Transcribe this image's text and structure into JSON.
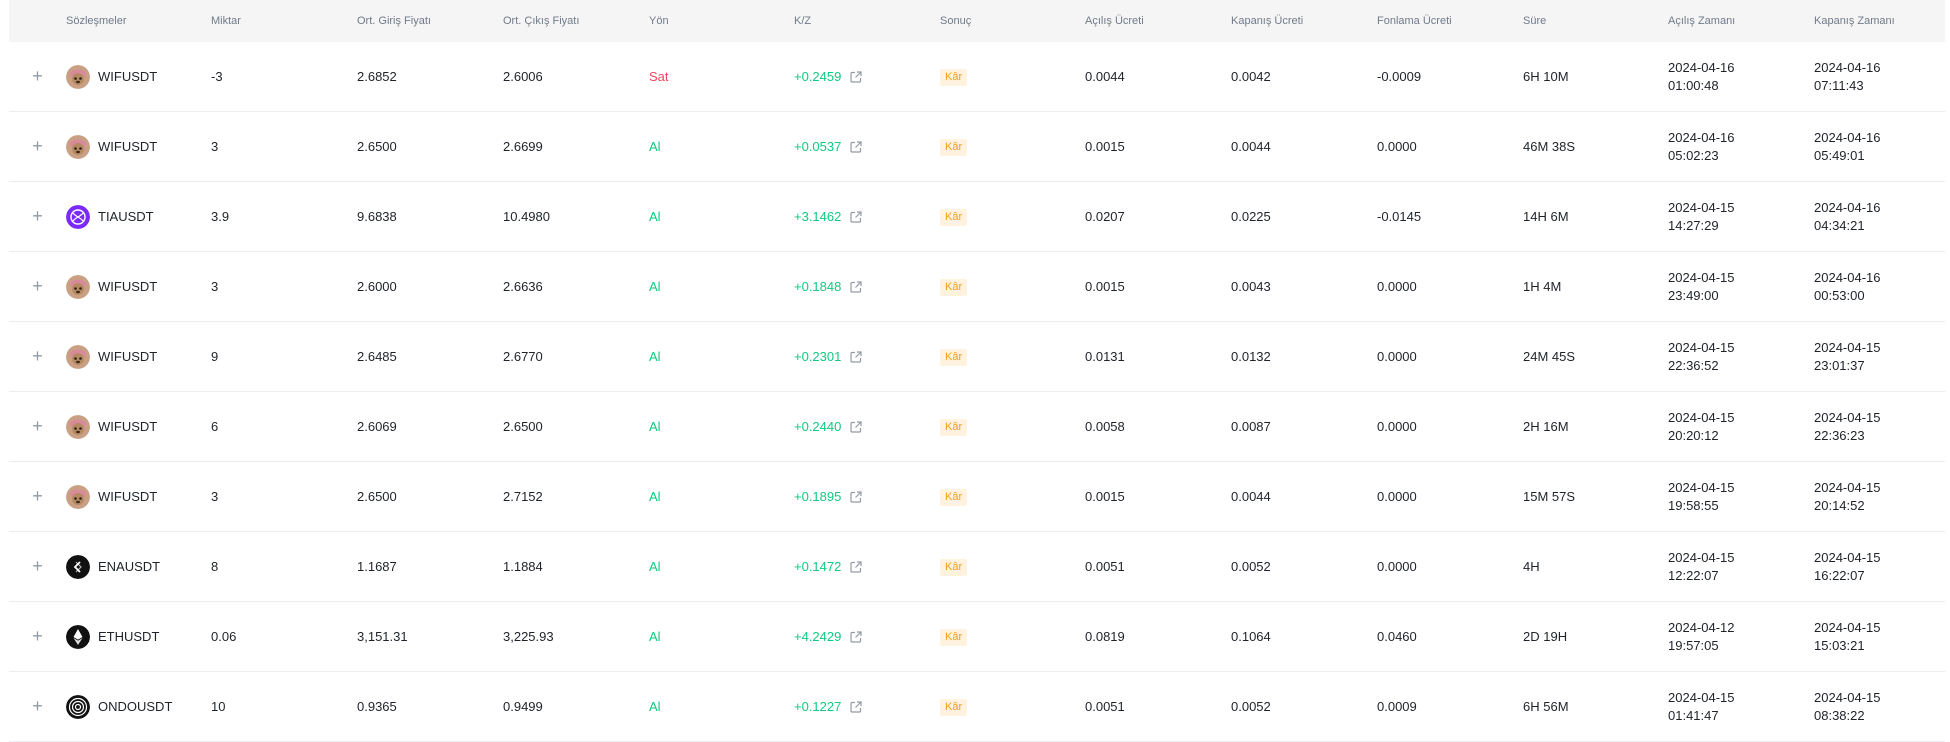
{
  "columns": {
    "symbol": "Sözleşmeler",
    "qty": "Miktar",
    "entry": "Ort. Giriş Fiyatı",
    "exit": "Ort. Çıkış Fiyatı",
    "side": "Yön",
    "pnl": "K/Z",
    "result": "Sonuç",
    "open_fee": "Açılış Ücreti",
    "close_fee": "Kapanış Ücreti",
    "funding_fee": "Fonlama Ücreti",
    "duration": "Süre",
    "open_time": "Açılış Zamanı",
    "close_time": "Kapanış Zamanı"
  },
  "colors": {
    "sell": "#f6465d",
    "buy": "#0ecb81",
    "profit_badge_bg": "#fff3e0",
    "profit_badge_text": "#f0a01a"
  },
  "rows": [
    {
      "icon": "wif-avatar-icon",
      "symbol": "WIFUSDT",
      "qty": "-3",
      "entry": "2.6852",
      "exit": "2.6006",
      "side": "Sat",
      "side_type": "sell",
      "pnl": "+0.2459",
      "result": "Kâr",
      "open_fee": "0.0044",
      "close_fee": "0.0042",
      "funding_fee": "-0.0009",
      "duration": "6H 10M",
      "open_date": "2024-04-16",
      "open_clock": "01:00:48",
      "close_date": "2024-04-16",
      "close_clock": "07:11:43"
    },
    {
      "icon": "wif-avatar-icon",
      "symbol": "WIFUSDT",
      "qty": "3",
      "entry": "2.6500",
      "exit": "2.6699",
      "side": "Al",
      "side_type": "buy",
      "pnl": "+0.0537",
      "result": "Kâr",
      "open_fee": "0.0015",
      "close_fee": "0.0044",
      "funding_fee": "0.0000",
      "duration": "46M 38S",
      "open_date": "2024-04-16",
      "open_clock": "05:02:23",
      "close_date": "2024-04-16",
      "close_clock": "05:49:01"
    },
    {
      "icon": "tia-icon",
      "symbol": "TIAUSDT",
      "qty": "3.9",
      "entry": "9.6838",
      "exit": "10.4980",
      "side": "Al",
      "side_type": "buy",
      "pnl": "+3.1462",
      "result": "Kâr",
      "open_fee": "0.0207",
      "close_fee": "0.0225",
      "funding_fee": "-0.0145",
      "duration": "14H 6M",
      "open_date": "2024-04-15",
      "open_clock": "14:27:29",
      "close_date": "2024-04-16",
      "close_clock": "04:34:21"
    },
    {
      "icon": "wif-avatar-icon",
      "symbol": "WIFUSDT",
      "qty": "3",
      "entry": "2.6000",
      "exit": "2.6636",
      "side": "Al",
      "side_type": "buy",
      "pnl": "+0.1848",
      "result": "Kâr",
      "open_fee": "0.0015",
      "close_fee": "0.0043",
      "funding_fee": "0.0000",
      "duration": "1H 4M",
      "open_date": "2024-04-15",
      "open_clock": "23:49:00",
      "close_date": "2024-04-16",
      "close_clock": "00:53:00"
    },
    {
      "icon": "wif-avatar-icon",
      "symbol": "WIFUSDT",
      "qty": "9",
      "entry": "2.6485",
      "exit": "2.6770",
      "side": "Al",
      "side_type": "buy",
      "pnl": "+0.2301",
      "result": "Kâr",
      "open_fee": "0.0131",
      "close_fee": "0.0132",
      "funding_fee": "0.0000",
      "duration": "24M 45S",
      "open_date": "2024-04-15",
      "open_clock": "22:36:52",
      "close_date": "2024-04-15",
      "close_clock": "23:01:37"
    },
    {
      "icon": "wif-avatar-icon",
      "symbol": "WIFUSDT",
      "qty": "6",
      "entry": "2.6069",
      "exit": "2.6500",
      "side": "Al",
      "side_type": "buy",
      "pnl": "+0.2440",
      "result": "Kâr",
      "open_fee": "0.0058",
      "close_fee": "0.0087",
      "funding_fee": "0.0000",
      "duration": "2H 16M",
      "open_date": "2024-04-15",
      "open_clock": "20:20:12",
      "close_date": "2024-04-15",
      "close_clock": "22:36:23"
    },
    {
      "icon": "wif-avatar-icon",
      "symbol": "WIFUSDT",
      "qty": "3",
      "entry": "2.6500",
      "exit": "2.7152",
      "side": "Al",
      "side_type": "buy",
      "pnl": "+0.1895",
      "result": "Kâr",
      "open_fee": "0.0015",
      "close_fee": "0.0044",
      "funding_fee": "0.0000",
      "duration": "15M 57S",
      "open_date": "2024-04-15",
      "open_clock": "19:58:55",
      "close_date": "2024-04-15",
      "close_clock": "20:14:52"
    },
    {
      "icon": "ena-icon",
      "symbol": "ENAUSDT",
      "qty": "8",
      "entry": "1.1687",
      "exit": "1.1884",
      "side": "Al",
      "side_type": "buy",
      "pnl": "+0.1472",
      "result": "Kâr",
      "open_fee": "0.0051",
      "close_fee": "0.0052",
      "funding_fee": "0.0000",
      "duration": "4H",
      "open_date": "2024-04-15",
      "open_clock": "12:22:07",
      "close_date": "2024-04-15",
      "close_clock": "16:22:07"
    },
    {
      "icon": "eth-icon",
      "symbol": "ETHUSDT",
      "qty": "0.06",
      "entry": "3,151.31",
      "exit": "3,225.93",
      "side": "Al",
      "side_type": "buy",
      "pnl": "+4.2429",
      "result": "Kâr",
      "open_fee": "0.0819",
      "close_fee": "0.1064",
      "funding_fee": "0.0460",
      "duration": "2D 19H",
      "open_date": "2024-04-12",
      "open_clock": "19:57:05",
      "close_date": "2024-04-15",
      "close_clock": "15:03:21"
    },
    {
      "icon": "ondo-icon",
      "symbol": "ONDOUSDT",
      "qty": "10",
      "entry": "0.9365",
      "exit": "0.9499",
      "side": "Al",
      "side_type": "buy",
      "pnl": "+0.1227",
      "result": "Kâr",
      "open_fee": "0.0051",
      "close_fee": "0.0052",
      "funding_fee": "0.0009",
      "duration": "6H 56M",
      "open_date": "2024-04-15",
      "open_clock": "01:41:47",
      "close_date": "2024-04-15",
      "close_clock": "08:38:22"
    }
  ]
}
